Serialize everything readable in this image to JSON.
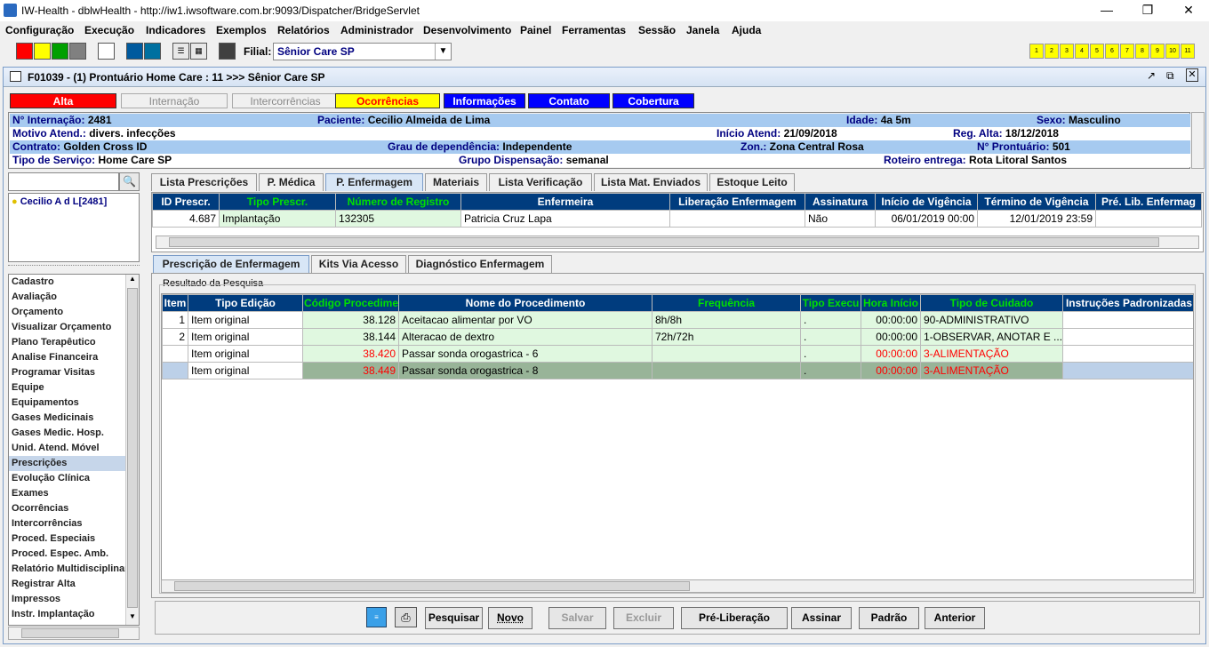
{
  "window": {
    "title": "IW-Health - dblwHealth - http://iw1.iwsoftware.com.br:9093/Dispatcher/BridgeServlet"
  },
  "menu": [
    "Configuração",
    "Execução",
    "Indicadores",
    "Exemplos",
    "Relatórios",
    "Administrador",
    "Desenvolvimento",
    "Painel",
    "Ferramentas",
    "Sessão",
    "Janela",
    "Ajuda"
  ],
  "toolbar": {
    "filial_label": "Filial:",
    "filial_value": "Sênior Care SP",
    "numbers": [
      "1",
      "2",
      "3",
      "4",
      "5",
      "6",
      "7",
      "8",
      "9",
      "10",
      "11"
    ]
  },
  "inner": {
    "title": "F01039 - (1) Prontuário Home Care : 11 >>> Sênior Care SP"
  },
  "status_buttons": [
    {
      "label": "Alta",
      "bg": "#ff0000",
      "fg": "#ffffff"
    },
    {
      "label": "Internação",
      "bg": "#f0f0f0",
      "fg": "#888888"
    },
    {
      "label": "Intercorrências",
      "bg": "#f0f0f0",
      "fg": "#888888"
    },
    {
      "label": "Ocorrências",
      "bg": "#ffff00",
      "fg": "#ff0000"
    },
    {
      "label": "Informações",
      "bg": "#0000ff",
      "fg": "#ffffff"
    },
    {
      "label": "Contato",
      "bg": "#0000ff",
      "fg": "#ffffff"
    },
    {
      "label": "Cobertura",
      "bg": "#0000ff",
      "fg": "#ffffff"
    }
  ],
  "patient": {
    "internacao_label": "N° Internação:",
    "internacao": "2481",
    "paciente_label": "Paciente:",
    "paciente": "Cecilio Almeida de Lima",
    "idade_label": "Idade:",
    "idade": "4a 5m",
    "sexo_label": "Sexo:",
    "sexo": "Masculino",
    "motivo_label": "Motivo Atend.:",
    "motivo": "divers. infecções",
    "inicio_label": "Início Atend:",
    "inicio": "21/09/2018",
    "regalta_label": "Reg. Alta:",
    "regalta": "18/12/2018",
    "contrato_label": "Contrato:",
    "contrato": "Golden Cross ID",
    "grau_label": "Grau de dependência:",
    "grau": "Independente",
    "zon_label": "Zon.:",
    "zon": "Zona Central Rosa",
    "pront_label": "N° Prontuário:",
    "pront": "501",
    "tiposerv_label": "Tipo de Serviço:",
    "tiposerv": "Home Care SP",
    "grupo_label": "Grupo Dispensação:",
    "grupo": "semanal",
    "roteiro_label": "Roteiro entrega:",
    "roteiro": "Rota Litoral Santos"
  },
  "left": {
    "patient_item": "Cecilio A d L[2481]",
    "nav": [
      "Cadastro",
      "Avaliação",
      "Orçamento",
      "Visualizar Orçamento",
      "Plano Terapêutico",
      "Analise Financeira",
      "Programar Visitas",
      "Equipe",
      "Equipamentos",
      "Gases Medicinais",
      "Gases Medic. Hosp.",
      "Unid. Atend. Móvel",
      "Prescrições",
      "Evolução Clínica",
      "Exames",
      "Ocorrências",
      "Intercorrências",
      "Proced. Especiais",
      "Proced. Espec. Amb.",
      "Relatório Multidisciplinar",
      "Registrar Alta",
      "Impressos",
      "Instr. Implantação"
    ],
    "selected": "Prescrições"
  },
  "tabs1": [
    "Lista Prescrições",
    "P. Médica",
    "P. Enfermagem",
    "Materiais",
    "Lista Verificação",
    "Lista Mat. Enviados",
    "Estoque Leito"
  ],
  "tabs1_active": "P. Enfermagem",
  "grid1": {
    "headers": [
      "ID Prescr.",
      "Tipo Prescr.",
      "Número de Registro",
      "Enfermeira",
      "Liberação Enfermagem",
      "Assinatura",
      "Início de Vigência",
      "Término de Vigência",
      "Pré. Lib. Enfermag"
    ],
    "rows": [
      [
        "4.687",
        "Implantação",
        "132305",
        "Patricia Cruz Lapa",
        "",
        "Não",
        "06/01/2019 00:00",
        "12/01/2019 23:59",
        ""
      ]
    ]
  },
  "tabs2": [
    "Prescrição de Enfermagem",
    "Kits Via Acesso",
    "Diagnóstico Enfermagem"
  ],
  "tabs2_active": "Prescrição de Enfermagem",
  "group_label": "Resultado da Pesquisa",
  "grid2": {
    "headers": [
      "Item",
      "Tipo Edição",
      "Código Procedime",
      "Nome do Procedimento",
      "Frequência",
      "Tipo Execu",
      "Hora Início",
      "Tipo de Cuidado",
      "Instruções Padronizadas"
    ],
    "rows": [
      [
        "1",
        "Item original",
        "38.128",
        "Aceitacao alimentar por VO",
        "8h/8h",
        ".",
        "00:00:00",
        "90-ADMINISTRATIVO",
        ""
      ],
      [
        "2",
        "Item original",
        "38.144",
        "Alteracao de dextro",
        "72h/72h",
        ".",
        "00:00:00",
        "1-OBSERVAR, ANOTAR E ...",
        ""
      ],
      [
        "",
        "Item original",
        "38.420",
        "Passar sonda orogastrica - 6",
        "",
        ".",
        "00:00:00",
        "3-ALIMENTAÇÃO",
        ""
      ],
      [
        "",
        "Item original",
        "38.449",
        "Passar sonda orogastrica - 8",
        "",
        ".",
        "00:00:00",
        "3-ALIMENTAÇÃO",
        ""
      ]
    ]
  },
  "buttons": {
    "pesquisar": "Pesquisar",
    "novo": "Novo",
    "salvar": "Salvar",
    "excluir": "Excluir",
    "preliberacao": "Pré-Liberação",
    "assinar": "Assinar",
    "padrao": "Padrão",
    "anterior": "Anterior"
  }
}
